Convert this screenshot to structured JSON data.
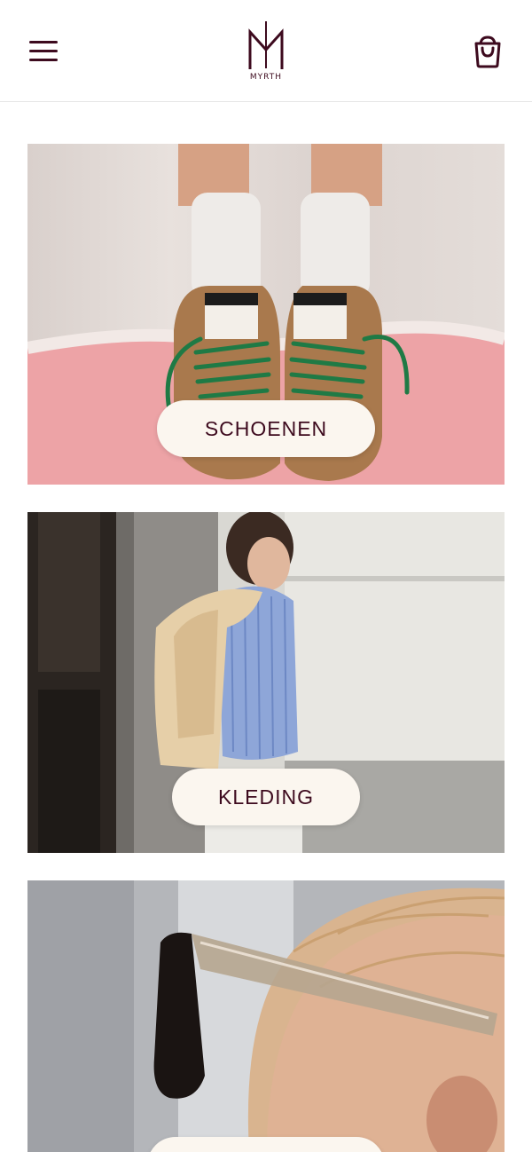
{
  "header": {
    "brand": "MYRTH",
    "menu_icon": "hamburger-menu-icon",
    "cart_icon": "shopping-bag-icon"
  },
  "categories": [
    {
      "label": "SCHOENEN",
      "image": "sneakers-with-green-laces-photo"
    },
    {
      "label": "KLEDING",
      "image": "woman-in-striped-shirt-photo"
    },
    {
      "label": "",
      "image": "sunglasses-closeup-photo"
    }
  ],
  "colors": {
    "brand": "#3d0a1e",
    "button_bg": "#fbf6ef",
    "background": "#ffffff"
  }
}
